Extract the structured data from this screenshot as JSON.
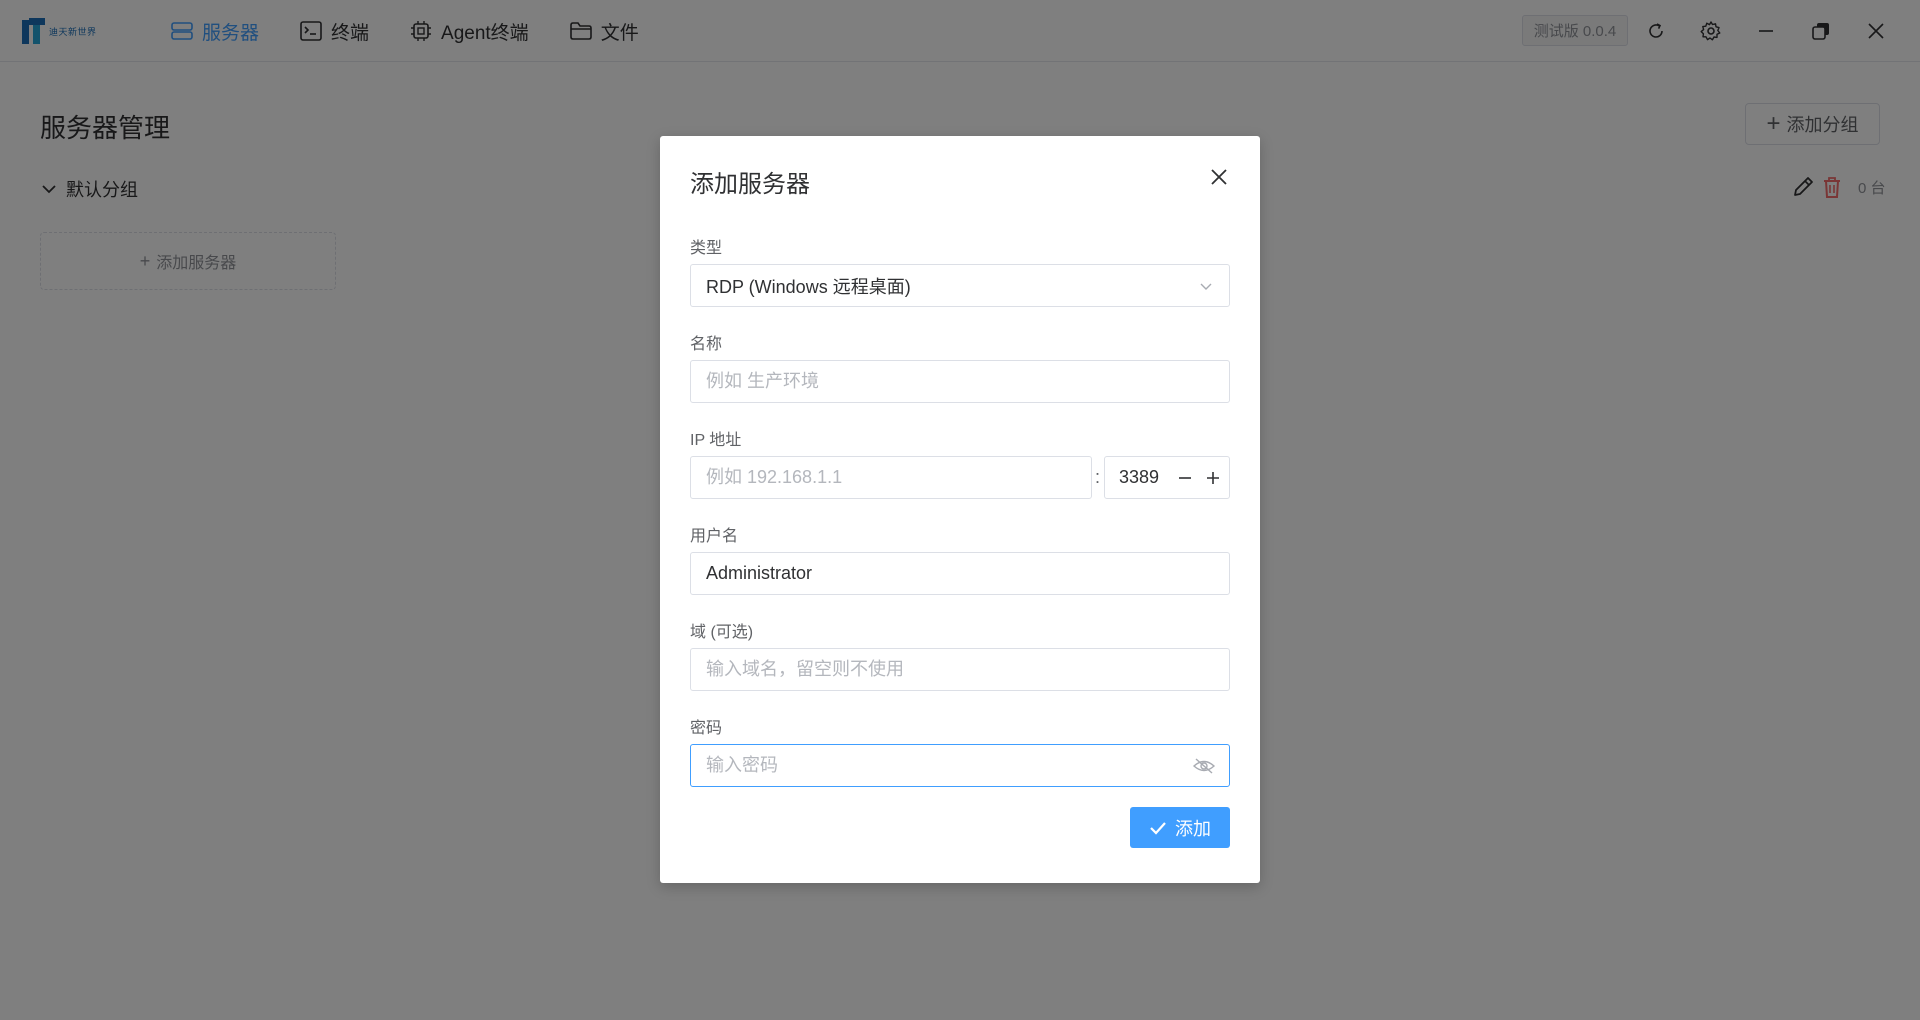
{
  "app": {
    "logo_text": "迪天新世界"
  },
  "nav": {
    "items": [
      {
        "label": "服务器",
        "icon": "server-icon",
        "active": true
      },
      {
        "label": "终端",
        "icon": "terminal-icon"
      },
      {
        "label": "Agent终端",
        "icon": "cpu-chip-icon"
      },
      {
        "label": "文件",
        "icon": "folder-icon"
      }
    ]
  },
  "titlebar": {
    "version": "测试版 0.0.4",
    "icons": [
      "refresh-icon",
      "gear-icon",
      "minimize-icon",
      "restore-icon",
      "close-icon"
    ]
  },
  "page": {
    "title": "服务器管理",
    "add_group_label": "添加分组",
    "group": {
      "name": "默认分组",
      "count": "0 台"
    },
    "add_server_label": "添加服务器"
  },
  "dialog": {
    "title": "添加服务器",
    "type": {
      "label": "类型",
      "value": "RDP (Windows 远程桌面)"
    },
    "name": {
      "label": "名称",
      "placeholder": "例如 生产环境"
    },
    "ip": {
      "label": "IP 地址",
      "placeholder": "例如 192.168.1.1",
      "separator": ":",
      "port": "3389"
    },
    "username": {
      "label": "用户名",
      "value": "Administrator"
    },
    "domain": {
      "label": "域 (可选)",
      "placeholder": "输入域名，留空则不使用"
    },
    "password": {
      "label": "密码",
      "placeholder": "输入密码"
    },
    "submit_label": "添加"
  },
  "colors": {
    "accent": "#409eff",
    "danger": "#f56c6c",
    "overlay": "rgba(0,0,0,0.5)"
  }
}
